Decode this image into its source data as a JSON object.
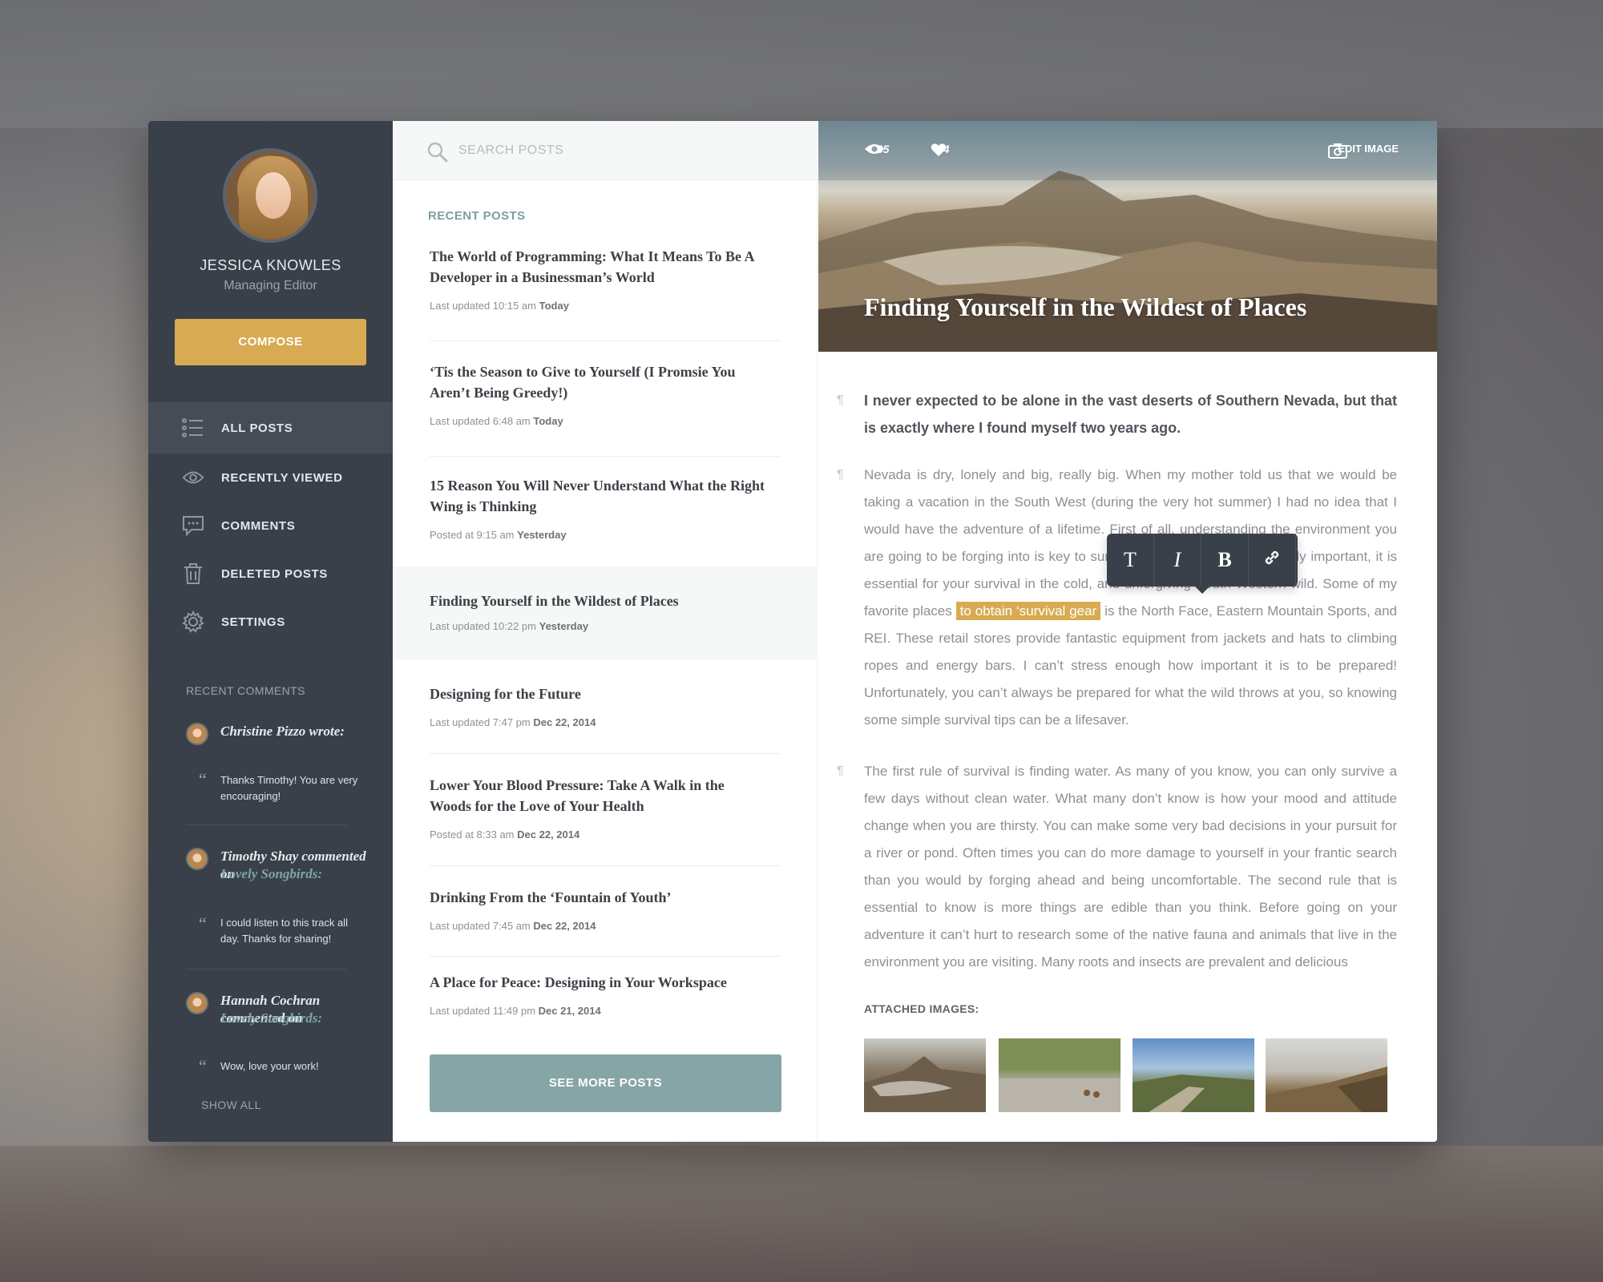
{
  "sidebar": {
    "user_name": "JESSICA KNOWLES",
    "user_role": "Managing Editor",
    "compose_label": "COMPOSE",
    "nav": [
      {
        "label": "ALL POSTS",
        "icon": "list-icon"
      },
      {
        "label": "RECENTLY VIEWED",
        "icon": "eye-icon"
      },
      {
        "label": "COMMENTS",
        "icon": "comment-icon"
      },
      {
        "label": "DELETED POSTS",
        "icon": "trash-icon"
      },
      {
        "label": "SETTINGS",
        "icon": "gear-icon"
      }
    ],
    "recent_comments_title": "RECENT COMMENTS",
    "comments": [
      {
        "name": "Christine Pizzo",
        "action": "wrote:",
        "post": "",
        "text": "Thanks Timothy! You are very encouraging!"
      },
      {
        "name": "Timothy Shay",
        "action": "commented on",
        "post": "Lovely Songbirds:",
        "text": "I could listen to this track all day. Thanks for sharing!"
      },
      {
        "name": "Hannah Cochran",
        "action": "commented on",
        "post": "Lovely Songbirds:",
        "text": "Wow, love your work!"
      }
    ],
    "show_all": "SHOW ALL"
  },
  "middle": {
    "search_placeholder": "SEARCH POSTS",
    "recent_title": "RECENT POSTS",
    "posts": [
      {
        "title": "The World of Programming: What It Means To Be A Developer in a Businessman’s World",
        "meta": "Last updated 10:15 am",
        "when": "Today"
      },
      {
        "title": "‘Tis the Season to Give to Yourself (I Promsie You Aren’t Being Greedy!)",
        "meta": "Last updated 6:48 am",
        "when": "Today"
      },
      {
        "title": "15 Reason You Will Never Understand What the Right Wing is Thinking",
        "meta": "Posted at 9:15 am",
        "when": "Yesterday"
      },
      {
        "title": "Finding Yourself in the Wildest of Places",
        "meta": "Last updated 10:22 pm",
        "when": "Yesterday"
      },
      {
        "title": "Designing for the Future",
        "meta": "Last updated 7:47 pm",
        "when": "Dec 22, 2014"
      },
      {
        "title": "Lower Your Blood Pressure: Take A Walk in the Woods for the Love of Your Health",
        "meta": "Posted at 8:33 am",
        "when": "Dec 22, 2014"
      },
      {
        "title": "Drinking From the ‘Fountain of Youth’",
        "meta": "Last updated 7:45 am",
        "when": "Dec 22, 2014"
      },
      {
        "title": "A Place for Peace: Designing in Your Workspace",
        "meta": "Last updated 11:49 pm",
        "when": "Dec 21, 2014"
      }
    ],
    "see_more": "SEE MORE POSTS"
  },
  "article": {
    "views": "285",
    "likes": "44",
    "edit_image": "EDIT IMAGE",
    "title": "Finding Yourself in the Wildest of Places",
    "lead": "I never expected to be alone in the vast deserts of Southern Nevada, but that is exactly where I found myself two years ago.",
    "p1_before": "Nevada is dry, lonely and big, really big.  When my mother told us that we would be taking a vacation in the South West (during the very hot summer) I had no idea that I would have the adventure of a lifetime. First of all, understanding the environment you are going to be forging into is key to survival. Being prepared is not only important, it is essential for your survival in the cold, and unforgiving South Western wild. Some of my favorite places",
    "p1_highlight": "to obtain ‘survival gear",
    "p1_after": "is the North Face, Eastern Mountain Sports, and REI. These retail stores provide fantastic equipment from jackets and hats to climbing ropes and energy bars. I can’t stress enough how important it is to be prepared! Unfortunately, you can’t always be prepared for what the wild throws at you, so knowing some simple survival tips can be a lifesaver.",
    "p2": "The first rule of survival is finding water. As many of you know, you can only survive a few days without clean water. What many don’t know is how your mood and attitude change when you are thirsty. You can make some very bad decisions in your pursuit for a river or pond. Often times you can do more damage to yourself in your frantic search than you would by forging ahead and being uncomfortable. The second rule that is essential to know is more things are edible than you think. Before going on your adventure it can’t hurt to research some of the native fauna and animals that live in the environment you are visiting. Many roots and insects are prevalent and delicious",
    "attached_title": "ATTACHED IMAGES:",
    "toolbar": [
      "T",
      "I",
      "B",
      "link-icon"
    ]
  },
  "colors": {
    "accent": "#d8ab52",
    "sidebar_bg": "#3a4049",
    "teal": "#86a5a6"
  }
}
